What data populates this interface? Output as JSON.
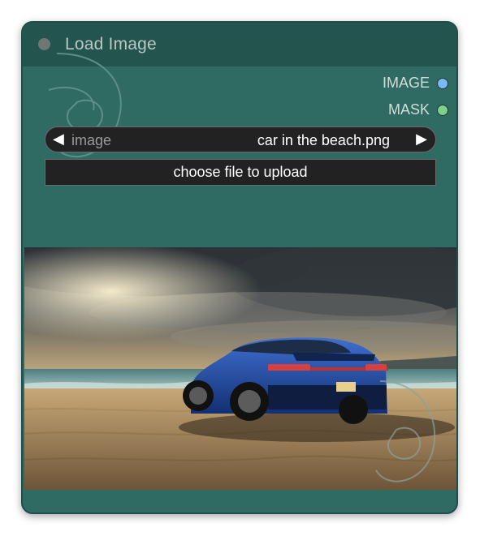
{
  "node": {
    "title": "Load Image",
    "outputs": [
      {
        "label": "IMAGE",
        "color": "#7cb8f5"
      },
      {
        "label": "MASK",
        "color": "#7ed08b"
      }
    ],
    "combo": {
      "label": "image",
      "value": "car in the beach.png",
      "left_arrow": "◀",
      "right_arrow": "▶"
    },
    "upload_label": "choose file to upload",
    "preview_icon": "image-preview",
    "accent": "#2f6a63",
    "title_bar_color": "#24544e"
  }
}
